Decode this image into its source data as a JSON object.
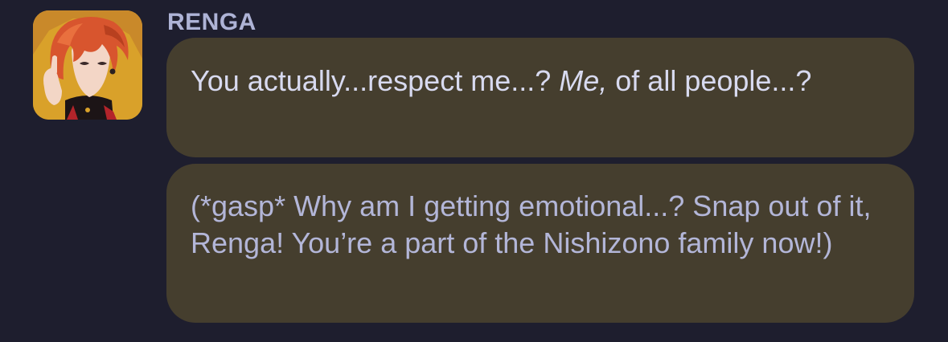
{
  "message": {
    "sender": "RENGA",
    "bubbles": [
      {
        "text_before": "You actually...respect me...? ",
        "text_emphasis": "Me,",
        "text_after": " of all people...?"
      },
      {
        "text": "(*gasp* Why am I getting emotional...? Snap out of it, Renga! You’re a part of the Nishizono family now!)"
      }
    ]
  },
  "colors": {
    "background": "#1e1e2e",
    "bubble": "#453e2e",
    "sender_name": "#aeb3d6",
    "speech_text": "#d8daf0",
    "action_text": "#b3b6d8"
  },
  "icons": {
    "avatar": "character-avatar"
  }
}
